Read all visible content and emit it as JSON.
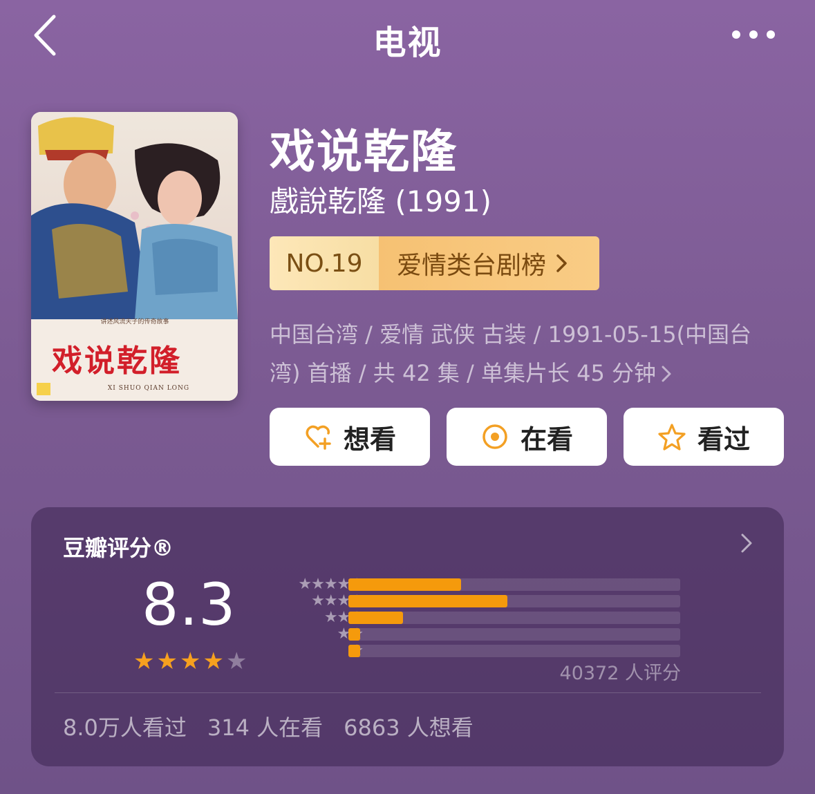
{
  "header": {
    "title": "电视",
    "back_icon": "chevron-left-icon",
    "more_icon": "more-dots-icon"
  },
  "movie": {
    "title": "戏说乾隆",
    "original_title": "戲說乾隆 (1991)",
    "poster_title": "戏说乾隆",
    "poster_subtitle": "XI SHUO QIAN LONG",
    "rank_no": "NO.19",
    "rank_list": "爱情类台剧榜",
    "meta_text": "中国台湾 / 爱情 武侠 古装 / 1991-05-15(中国台湾) 首播 / 共 42 集 / 单集片长 45 分钟"
  },
  "actions": [
    {
      "label": "想看",
      "icon": "heart-plus-icon"
    },
    {
      "label": "在看",
      "icon": "target-circle-icon"
    },
    {
      "label": "看过",
      "icon": "star-outline-icon"
    }
  ],
  "rating": {
    "label": "豆瓣评分®",
    "score": "8.3",
    "score_stars": 4,
    "distribution": [
      {
        "stars": "★★★★★",
        "fraction": 0.34
      },
      {
        "stars": "★★★★",
        "fraction": 0.48
      },
      {
        "stars": "★★★",
        "fraction": 0.165
      },
      {
        "stars": "★★",
        "fraction": 0.035
      },
      {
        "stars": "★",
        "fraction": 0.035
      }
    ],
    "total": "40372 人评分",
    "stats": [
      "8.0万人看过",
      "314 人在看",
      "6863 人想看"
    ]
  },
  "colors": {
    "accent": "#f59a0c",
    "background": "#8a64a2"
  }
}
